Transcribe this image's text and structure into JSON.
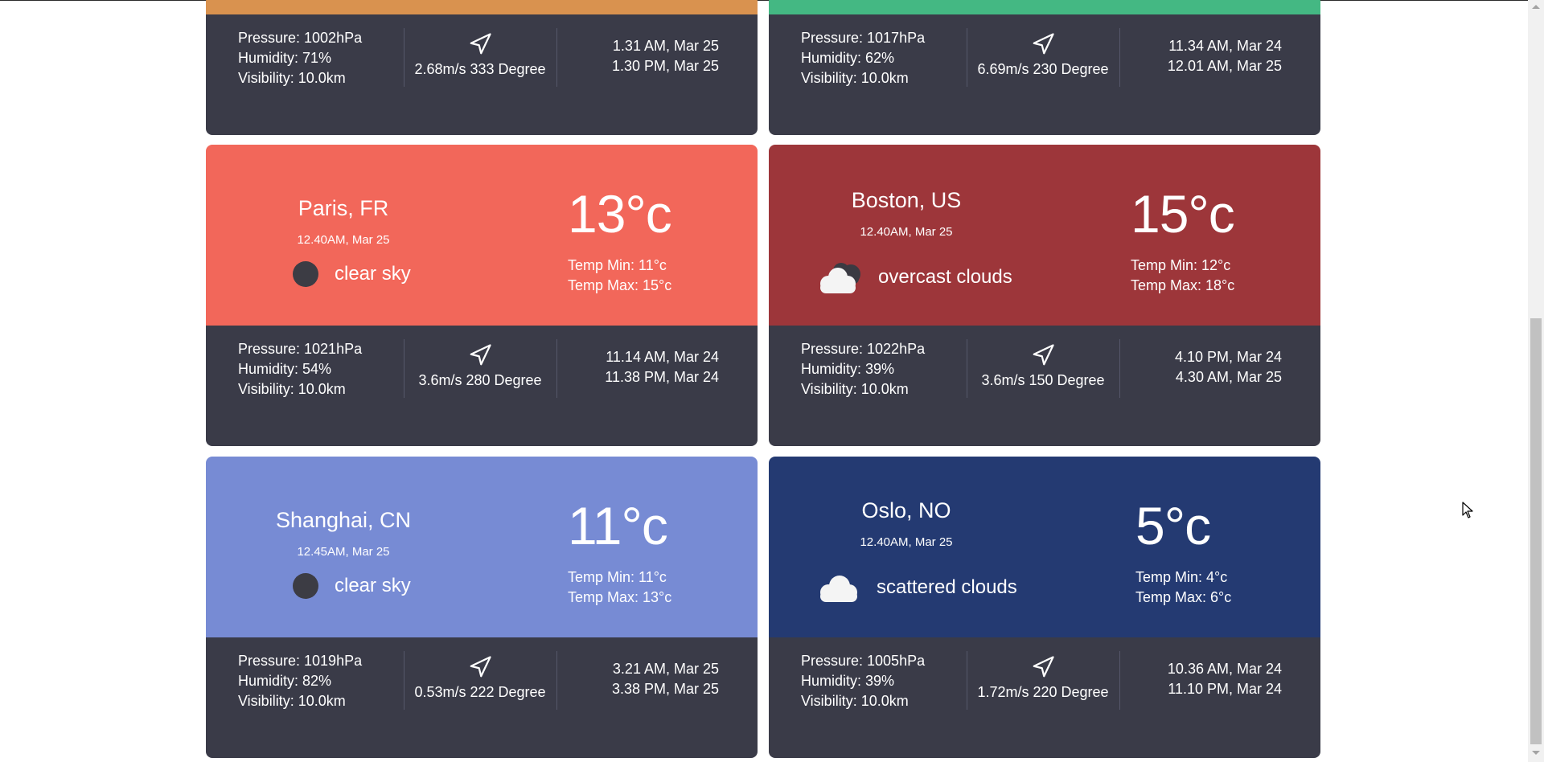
{
  "cards": [
    {
      "top_color": "#d9924f",
      "pressure": "Pressure: 1002hPa",
      "humidity": "Humidity: 71%",
      "visibility": "Visibility: 10.0km",
      "wind": "2.68m/s 333 Degree",
      "sunrise": "1.31 AM, Mar 25",
      "sunset": "1.30 PM, Mar 25"
    },
    {
      "top_color": "#44b883",
      "pressure": "Pressure: 1017hPa",
      "humidity": "Humidity: 62%",
      "visibility": "Visibility: 10.0km",
      "wind": "6.69m/s 230 Degree",
      "sunrise": "11.34 AM, Mar 24",
      "sunset": "12.01 AM, Mar 25"
    },
    {
      "top_color": "#f2675a",
      "city": "Paris, FR",
      "date": "12.40AM, Mar 25",
      "icon": "clear-sky-icon",
      "description": "clear sky",
      "temp": "13°c",
      "temp_min": "Temp Min: 11°c",
      "temp_max": "Temp Max: 15°c",
      "pressure": "Pressure: 1021hPa",
      "humidity": "Humidity: 54%",
      "visibility": "Visibility: 10.0km",
      "wind": "3.6m/s 280 Degree",
      "sunrise": "11.14 AM, Mar 24",
      "sunset": "11.38 PM, Mar 24"
    },
    {
      "top_color": "#9d363a",
      "city": "Boston, US",
      "date": "12.40AM, Mar 25",
      "icon": "overcast-clouds-icon",
      "description": "overcast clouds",
      "temp": "15°c",
      "temp_min": "Temp Min: 12°c",
      "temp_max": "Temp Max: 18°c",
      "pressure": "Pressure: 1022hPa",
      "humidity": "Humidity: 39%",
      "visibility": "Visibility: 10.0km",
      "wind": "3.6m/s 150 Degree",
      "sunrise": "4.10 PM, Mar 24",
      "sunset": "4.30 AM, Mar 25"
    },
    {
      "top_color": "#778bd4",
      "city": "Shanghai, CN",
      "date": "12.45AM, Mar 25",
      "icon": "clear-sky-icon",
      "description": "clear sky",
      "temp": "11°c",
      "temp_min": "Temp Min: 11°c",
      "temp_max": "Temp Max: 13°c",
      "pressure": "Pressure: 1019hPa",
      "humidity": "Humidity: 82%",
      "visibility": "Visibility: 10.0km",
      "wind": "0.53m/s 222 Degree",
      "sunrise": "3.21 AM, Mar 25",
      "sunset": "3.38 PM, Mar 25"
    },
    {
      "top_color": "#243a72",
      "city": "Oslo, NO",
      "date": "12.40AM, Mar 25",
      "icon": "scattered-clouds-icon",
      "description": "scattered clouds",
      "temp": "5°c",
      "temp_min": "Temp Min: 4°c",
      "temp_max": "Temp Max: 6°c",
      "pressure": "Pressure: 1005hPa",
      "humidity": "Humidity: 39%",
      "visibility": "Visibility: 10.0km",
      "wind": "1.72m/s 220 Degree",
      "sunrise": "10.36 AM, Mar 24",
      "sunset": "11.10 PM, Mar 24"
    }
  ]
}
